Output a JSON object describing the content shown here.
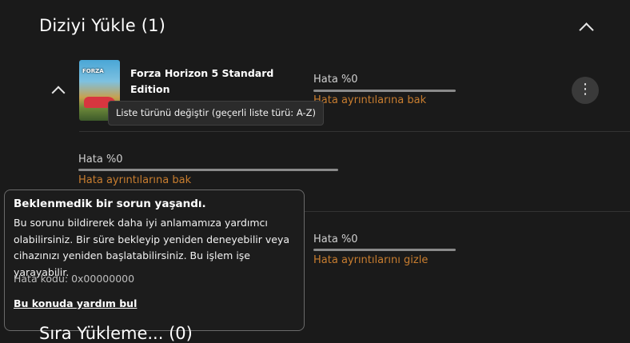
{
  "section": {
    "title": "Diziyi Yükle (1)"
  },
  "game": {
    "title": "Forza Horizon 5 Standard Edition",
    "thumb_label": "FORZA"
  },
  "progress_rows": [
    {
      "label": "Hata %0",
      "progress": 0,
      "link": "Hata ayrıntılarına bak"
    },
    {
      "label": "Hata %0",
      "progress": 0,
      "link": "Hata ayrıntılarına bak"
    },
    {
      "label": "Hata %0",
      "progress": 0,
      "link": "Hata ayrıntılarını gizle"
    }
  ],
  "more_button": {
    "glyph": "⋮"
  },
  "tooltip": {
    "text": "Liste türünü değiştir (geçerli liste türü: A-Z)"
  },
  "dialog": {
    "title": "Beklenmedik bir sorun yaşandı.",
    "body": "Bu sorunu bildirerek daha iyi anlamamıza yardımcı olabilirsiniz. Bir süre bekleyip yeniden deneyebilir veya cihazınızı yeniden başlatabilirsiniz. Bu işlem işe yarayabilir.",
    "error_code": "Hata kodu: 0x00000000",
    "help_link": "Bu konuda yardım bul"
  },
  "bottom_section": {
    "title": "Sıra Yükleme... (0)"
  },
  "colors": {
    "background": "#1a1a1a",
    "accent_link": "#c87d2f",
    "text": "#ffffff"
  }
}
